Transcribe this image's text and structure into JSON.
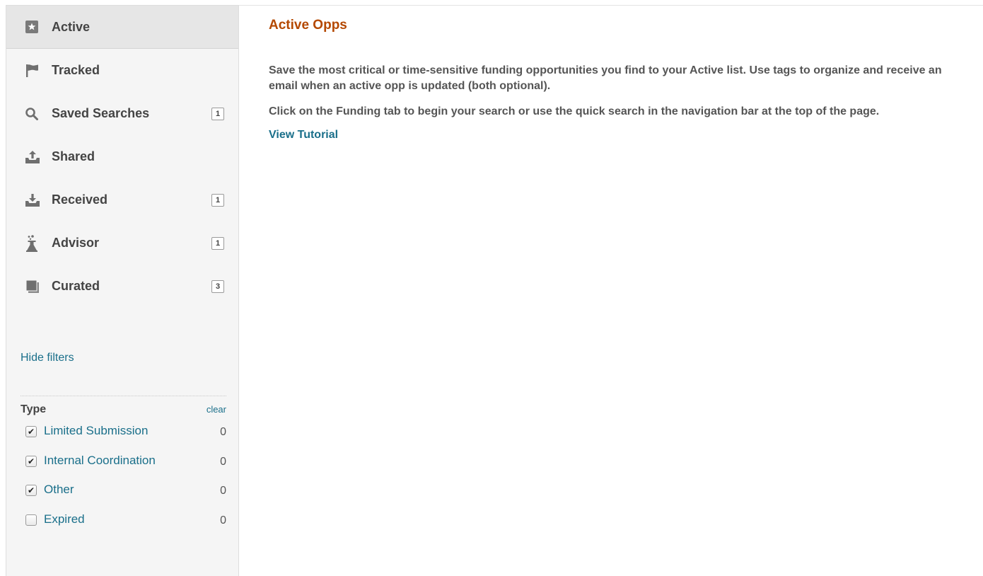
{
  "sidebar": {
    "nav": [
      {
        "label": "Active",
        "icon": "star-icon",
        "count": null
      },
      {
        "label": "Tracked",
        "icon": "flag-icon",
        "count": null
      },
      {
        "label": "Saved Searches",
        "icon": "search-icon",
        "count": "1"
      },
      {
        "label": "Shared",
        "icon": "tray-upload-icon",
        "count": null
      },
      {
        "label": "Received",
        "icon": "tray-download-icon",
        "count": "1"
      },
      {
        "label": "Advisor",
        "icon": "flask-icon",
        "count": "1"
      },
      {
        "label": "Curated",
        "icon": "documents-icon",
        "count": "3"
      }
    ],
    "hide_filters": "Hide filters",
    "filters": {
      "title": "Type",
      "clear": "clear",
      "items": [
        {
          "label": "Limited Submission",
          "checked": true,
          "count": "0"
        },
        {
          "label": "Internal Coordination",
          "checked": true,
          "count": "0"
        },
        {
          "label": "Other",
          "checked": true,
          "count": "0"
        },
        {
          "label": "Expired",
          "checked": false,
          "count": "0"
        }
      ]
    }
  },
  "main": {
    "title": "Active Opps",
    "paragraph1": "Save the most critical or time-sensitive funding opportunities you find to your Active list. Use tags to organize and receive an email when an active opp is updated (both optional).",
    "paragraph2": "Click on the Funding tab to begin your search or use the quick search in the navigation bar at the top of the page.",
    "tutorial_link": "View Tutorial"
  },
  "colors": {
    "title": "#b44800",
    "link": "#1a6f8a",
    "sidebar_bg": "#f5f5f5",
    "active_bg": "#e6e6e6"
  }
}
